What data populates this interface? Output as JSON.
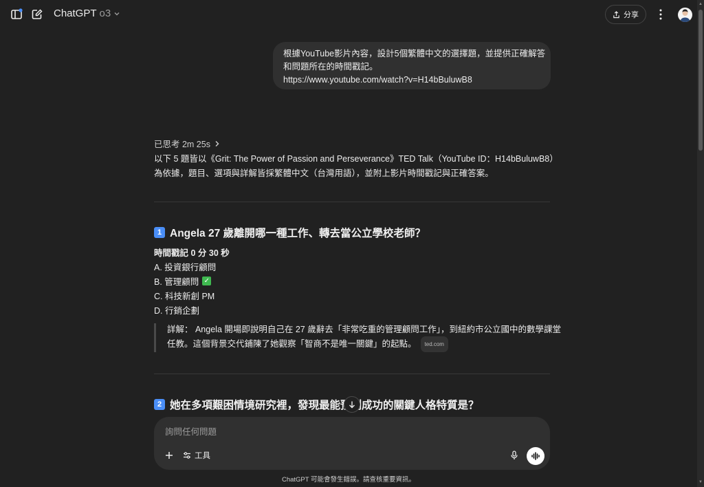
{
  "header": {
    "app_name": "ChatGPT",
    "model": "o3",
    "share_label": "分享"
  },
  "user_message": {
    "line1": "根據YouTube影片內容，設計5個繁體中文的選擇題，並提供正確解答",
    "line2": "和問題所在的時間戳記。",
    "line3": "https://www.youtube.com/watch?v=H14bBuluwB8"
  },
  "assistant": {
    "thought_label": "已思考 2m 25s",
    "intro_line1": "以下 5 題皆以《Grit: The Power of Passion and Perseverance》TED Talk（YouTube ID：H14bBuluwB8）",
    "intro_line2": "為依據，題目、選項與詳解皆採繁體中文（台灣用語），並附上影片時間戳記與正確答案。",
    "questions": [
      {
        "num": "1",
        "title": "Angela 27 歲離開哪一種工作、轉去當公立學校老師？",
        "timestamp": "時間戳記 0 分 30 秒",
        "options": [
          "A. 投資銀行顧問",
          "B. 管理顧問",
          "C. 科技新創 PM",
          "D. 行銷企劃"
        ],
        "correct_mark": "✓",
        "detail_line1": "詳解： Angela 開場即說明自己在 27 歲辭去「非常吃重的管理顧問工作」，到紐約市公立國中的數學課堂",
        "detail_line2": "任教。這個背景交代鋪陳了她觀察「智商不是唯一關鍵」的起點。",
        "citation": "ted.com"
      },
      {
        "num": "2",
        "title": "她在多項艱困情境研究裡，發現最能預測成功的關鍵人格特質是？"
      }
    ]
  },
  "composer": {
    "placeholder": "詢問任何問題",
    "tools_label": "工具"
  },
  "footer_text": "ChatGPT 可能會發生錯誤。請查核重要資訊。",
  "colors": {
    "background": "#212121",
    "bubble": "#303030",
    "badge": "#4a8ef7",
    "check": "#3fb950"
  }
}
